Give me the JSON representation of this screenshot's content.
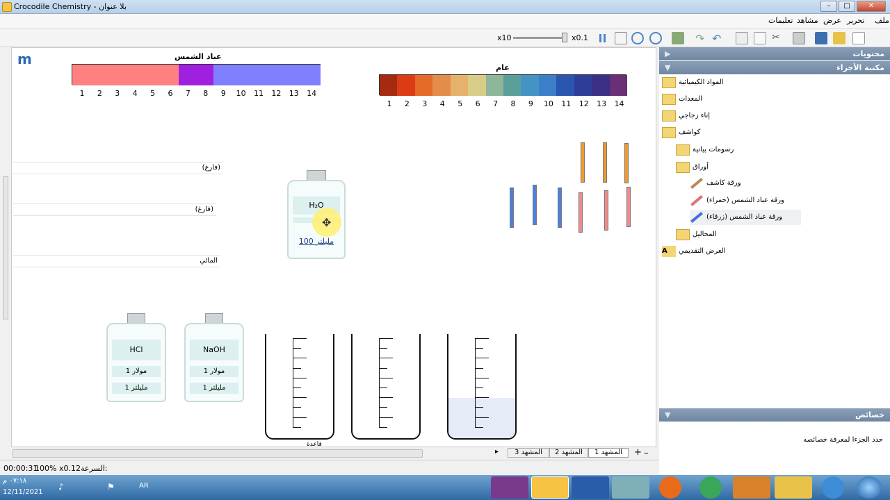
{
  "window": {
    "title": "Crocodile Chemistry - بلا عنوان",
    "min": "–",
    "max": "□",
    "close": "✕"
  },
  "menu": [
    "ملف",
    "تحرير",
    "عرض",
    "مشاهد",
    "تعليمات"
  ],
  "toolbar": {
    "zoom_max": "x10",
    "zoom_min": "x0.1"
  },
  "litmus": {
    "title": "عباد الشمس",
    "numbers": [
      "1",
      "2",
      "3",
      "4",
      "5",
      "6",
      "7",
      "8",
      "9",
      "10",
      "11",
      "12",
      "13",
      "14"
    ],
    "colors": {
      "acid": "#ff8080",
      "neutral": "#a020e0",
      "base": "#8080ff"
    }
  },
  "universal": {
    "title": "عام",
    "numbers": [
      "1",
      "2",
      "3",
      "4",
      "5",
      "6",
      "7",
      "8",
      "9",
      "10",
      "11",
      "12",
      "13",
      "14"
    ],
    "colors": [
      "#a52a10",
      "#dc3c14",
      "#e36a28",
      "#e48c4a",
      "#e5b26c",
      "#d8cd88",
      "#8fb59a",
      "#5b9f9a",
      "#4394c4",
      "#3b7fc8",
      "#2a56b0",
      "#2d3d98",
      "#3a2f86",
      "#6a2f74"
    ]
  },
  "fields": [
    "(فارغ)",
    "(فارغ)",
    "المائي"
  ],
  "water_bottle": {
    "formula": "H₂O",
    "volume": "100 مليلتر"
  },
  "bottles": [
    {
      "formula": "HCl",
      "concentration": "1 مولار",
      "volume": "1 مليلتر"
    },
    {
      "formula": "NaOH",
      "concentration": "1 مولار",
      "volume": "1 مليلتر"
    }
  ],
  "beaker_label": "قاعدة",
  "scenes": {
    "tabs": [
      "المشهد 1",
      "المشهد 2",
      "المشهد 3"
    ],
    "add": "+",
    "remove": "–",
    "next": "▸"
  },
  "status": {
    "time": "00:00:31",
    "zoom": "100%",
    "speed_value": "x0.12",
    "speed_label": "السرعة:"
  },
  "panel": {
    "contents": "محتويات",
    "parts_library": "مكتبة الأجزاء",
    "properties": "خصائص",
    "properties_hint": "حدد الجزءا لمعرفة خصائصه",
    "tree": [
      "المواد الكيميائية",
      "المعدات",
      "إناء زجاجي",
      "كواشف",
      "رسومات بيانية",
      "أوراق",
      "ورقة كاشف",
      "ورقة عباد الشمس (حمراء)",
      "ورقة عباد الشمس (زرقاء)",
      "المحاليل",
      "العرض التقديمي"
    ]
  },
  "taskbar": {
    "clock": "٠٧:١٨ م",
    "date": "12/11/2021",
    "lang": "AR"
  }
}
